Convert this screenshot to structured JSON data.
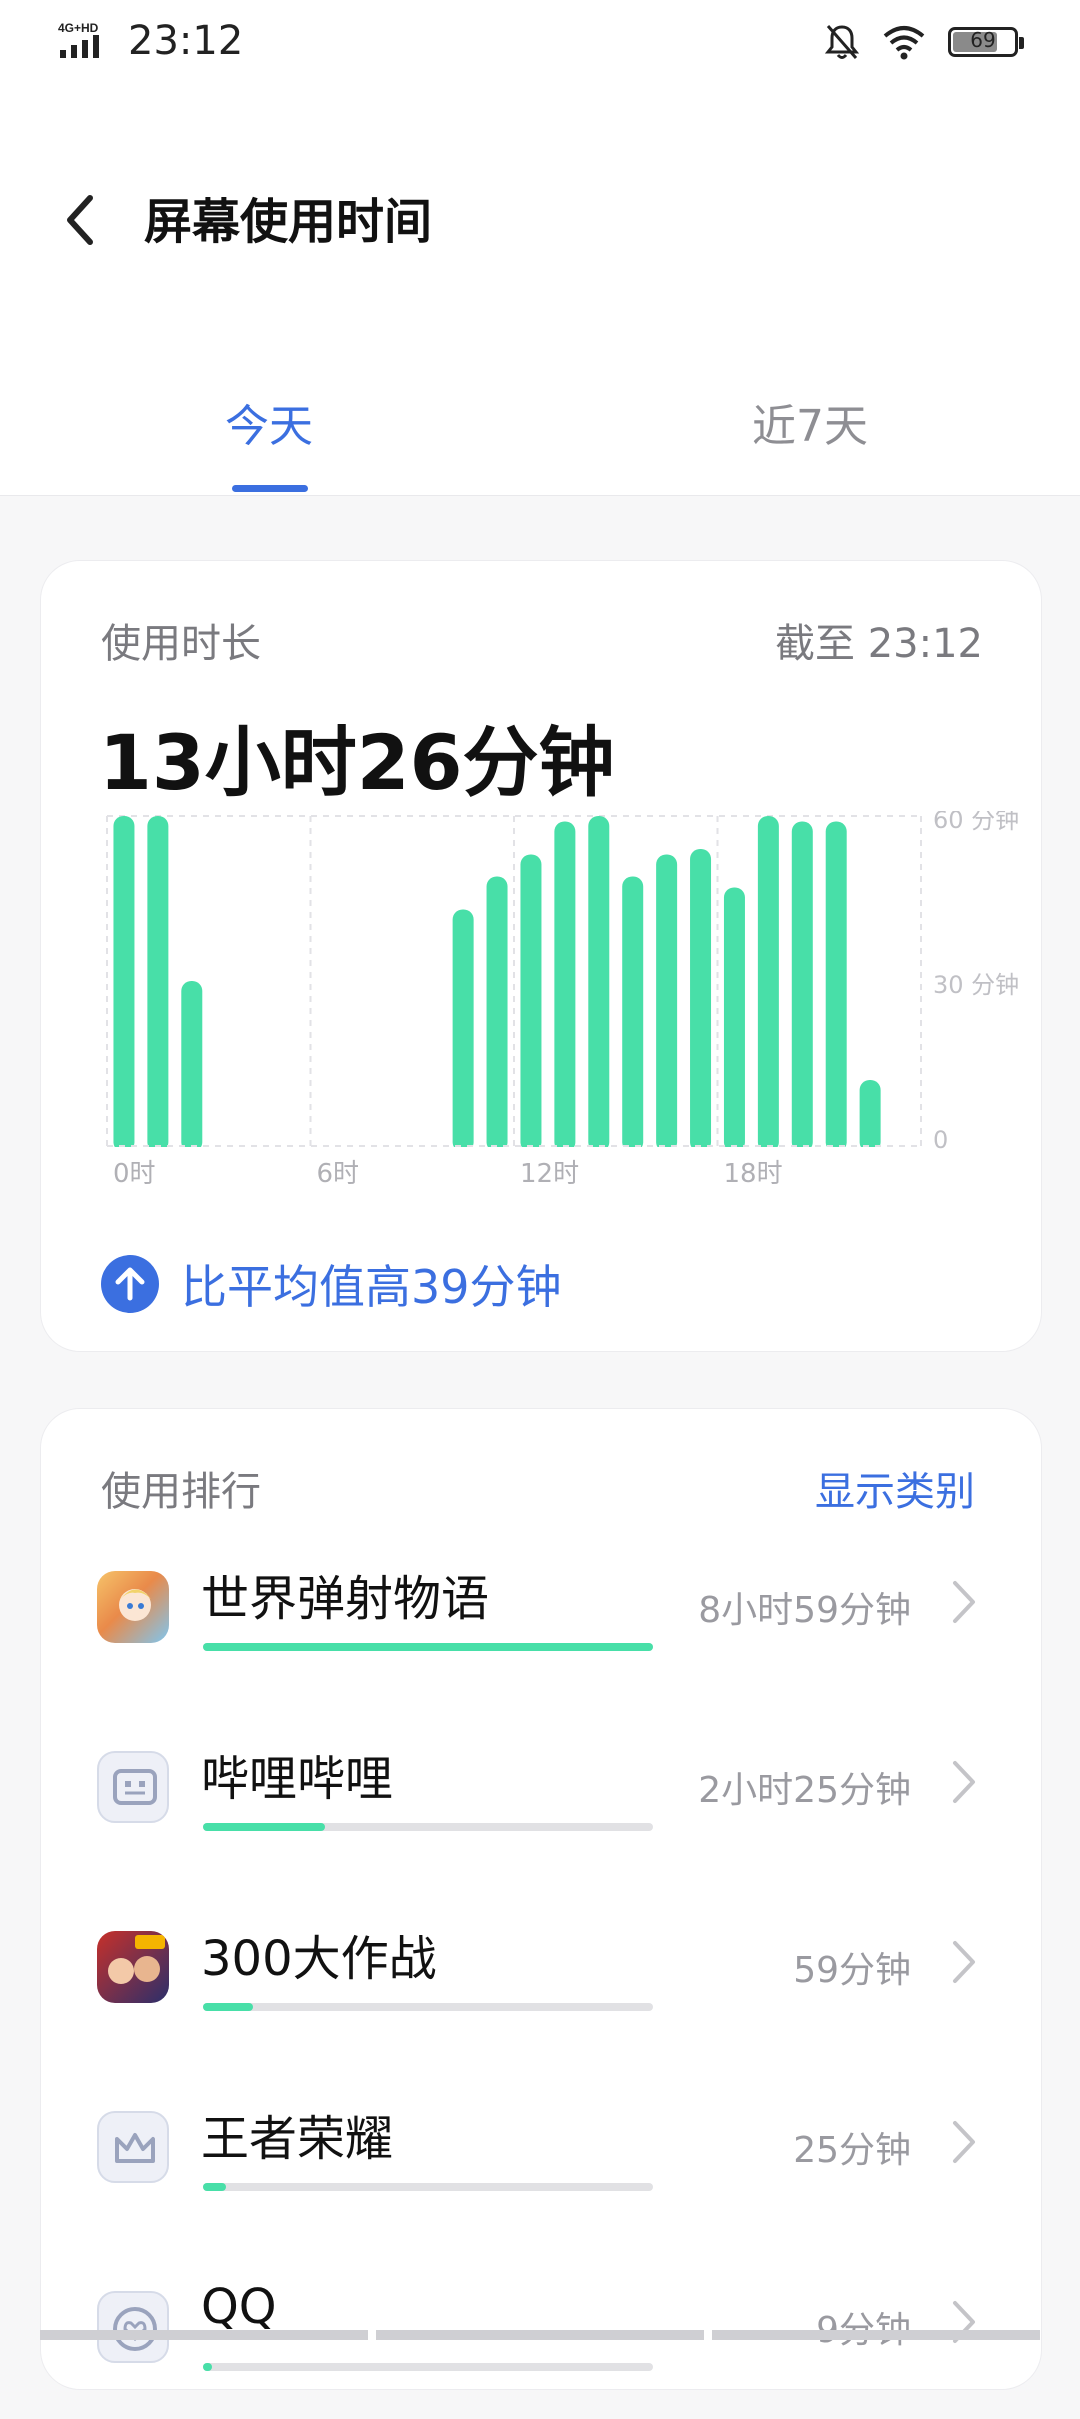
{
  "status_bar": {
    "network_label": "4G+HD",
    "time": "23:12",
    "battery_level": "69"
  },
  "header": {
    "title": "屏幕使用时间"
  },
  "tabs": [
    {
      "label": "今天",
      "active": true
    },
    {
      "label": "近7天",
      "active": false
    }
  ],
  "usage": {
    "label": "使用时长",
    "as_of": "截至 23:12",
    "total": "13小时26分钟",
    "compare_text": "比平均值高39分钟",
    "accent_color": "#3b6fe0",
    "bar_color": "#48dfa8"
  },
  "chart_data": {
    "type": "bar",
    "categories": [
      "0",
      "1",
      "2",
      "3",
      "4",
      "5",
      "6",
      "7",
      "8",
      "9",
      "10",
      "11",
      "12",
      "13",
      "14",
      "15",
      "16",
      "17",
      "18",
      "19",
      "20",
      "21",
      "22",
      "23"
    ],
    "values": [
      60,
      60,
      30,
      0,
      0,
      0,
      0,
      0,
      0,
      0,
      43,
      49,
      53,
      59,
      60,
      49,
      53,
      54,
      47,
      60,
      59,
      59,
      12,
      0
    ],
    "x_tick_labels": [
      {
        "index": 0,
        "label": "0时"
      },
      {
        "index": 6,
        "label": "6时"
      },
      {
        "index": 12,
        "label": "12时"
      },
      {
        "index": 18,
        "label": "18时"
      }
    ],
    "y_tick_labels": [
      {
        "value": 60,
        "label": "60 分钟"
      },
      {
        "value": 30,
        "label": "30 分钟"
      },
      {
        "value": 0,
        "label": "0"
      }
    ],
    "ylim": [
      0,
      60
    ],
    "grid": true
  },
  "ranking": {
    "label": "使用排行",
    "show_category": "显示类别",
    "apps": [
      {
        "name": "世界弹射物语",
        "time": "8小时59分钟",
        "fraction": 1.0,
        "icon": "world-flipper-app-icon"
      },
      {
        "name": "哔哩哔哩",
        "time": "2小时25分钟",
        "fraction": 0.27,
        "icon": "bilibili-app-icon"
      },
      {
        "name": "300大作战",
        "time": "59分钟",
        "fraction": 0.11,
        "icon": "300-battle-app-icon"
      },
      {
        "name": "王者荣耀",
        "time": "25分钟",
        "fraction": 0.05,
        "icon": "honor-of-kings-app-icon"
      },
      {
        "name": "QQ",
        "time": "9分钟",
        "fraction": 0.02,
        "icon": "qq-app-icon"
      }
    ]
  }
}
